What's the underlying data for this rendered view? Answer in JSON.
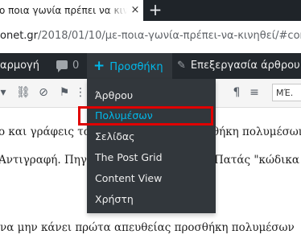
{
  "browser": {
    "tab_title": "ο ποια γωνία πρέπει να κινηθεί",
    "tab_close": "×",
    "new_tab": "+",
    "url_host": "onet.gr",
    "url_path": "/2018/01/10/με-ποια-γωνία-πρέπει-να-κινηθεί/#con"
  },
  "adminbar": {
    "apps_label": "αρμογή",
    "comments_count": "0",
    "new_label": "Προσθήκη",
    "edit_label": "Επεξεργασία άρθρου"
  },
  "toolbar": {
    "format_select": "ΜΈ."
  },
  "menu": {
    "items": [
      {
        "label": "Άρθρου"
      },
      {
        "label": "Πολυμέσων"
      },
      {
        "label": "Σελίδας"
      },
      {
        "label": "The Post Grid"
      },
      {
        "label": "Content View"
      },
      {
        "label": "Χρήστη"
      }
    ]
  },
  "content": {
    "line1_left": "ο και γράφεις το ",
    "line1_right": "θήκη πολυμέσων",
    "line2_left": "Αντιγραφή. Πηγα",
    "line2_right": " Πατάς \"κώδικα",
    "line3": "να μην κάνει πρώτα απευθείας προσθήκη πολυμέσων"
  },
  "colors": {
    "adminbar_bg": "#23282d",
    "menu_bg": "#32373c",
    "accent": "#00b9eb",
    "highlight": "#e00000"
  }
}
